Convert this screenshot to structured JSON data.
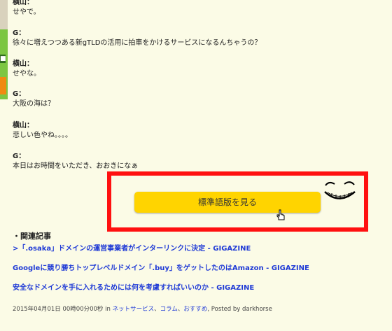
{
  "article": {
    "lines": [
      {
        "speaker": "横山：",
        "text": "せやで。"
      },
      {
        "speaker": "G：",
        "text": "徐々に増えつつある新gTLDの活用に拍車をかけるサービスになるんちゃうの？"
      },
      {
        "speaker": "横山：",
        "text": "せやな。"
      },
      {
        "speaker": "G：",
        "text": "大阪の海は？"
      },
      {
        "speaker": "横山：",
        "text": "悲しい色やね。。。。"
      },
      {
        "speaker": "G：",
        "text": "本日はお時間をいただき、おおきになぁ"
      }
    ]
  },
  "cta": {
    "label": "標準語版を見る"
  },
  "related": {
    "heading": "・関連記事",
    "links": [
      ">「.osaka」ドメインの運営事業者がインターリンクに決定 - GIGAZINE",
      "Googleに競り勝ちトップレベルドメイン「.buy」をゲットしたのはAmazon - GIGAZINE",
      "安全なドメインを手に入れるためには何を考慮すればいいのか - GIGAZINE"
    ]
  },
  "meta": {
    "date": "2015年04月01日 00時00分00秒 in",
    "category1": "ネットサービス",
    "sep1": "、",
    "category2": "コラム",
    "sep2": "、",
    "category3": "おすすめ",
    "posted": ", Posted by darkhorse"
  },
  "colors": {
    "highlight": "#ff1010",
    "button": "#ffd400",
    "link": "#1f3ad6"
  }
}
